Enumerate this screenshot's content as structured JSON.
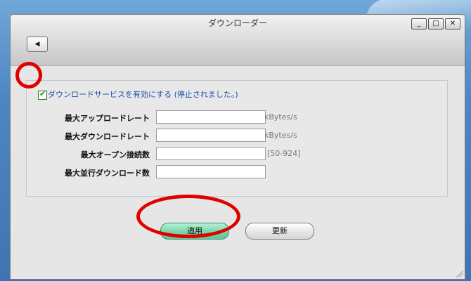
{
  "window": {
    "title": "ダウンローダー",
    "controls": {
      "minimize": "_",
      "maximize": "□",
      "close": "✕"
    },
    "back_glyph": "◀"
  },
  "service": {
    "enabled": true,
    "checkbox_mark": "✔",
    "label": "ダウンロードサービスを有効にする (停止されました。)"
  },
  "form": {
    "rows": [
      {
        "label": "最大アップロードレート",
        "value": "",
        "unit": "kBytes/s"
      },
      {
        "label": "最大ダウンロードレート",
        "value": "",
        "unit": "kBytes/s"
      },
      {
        "label": "最大オープン接続数",
        "value": "",
        "unit": "[50-924]"
      },
      {
        "label": "最大並行ダウンロード数",
        "value": "",
        "unit": ""
      }
    ]
  },
  "buttons": {
    "apply": "適用",
    "update": "更新"
  },
  "colors": {
    "annotation_ring": "#e00000",
    "apply_button": "#7fd7ae",
    "label_link": "#1f4fa8"
  }
}
